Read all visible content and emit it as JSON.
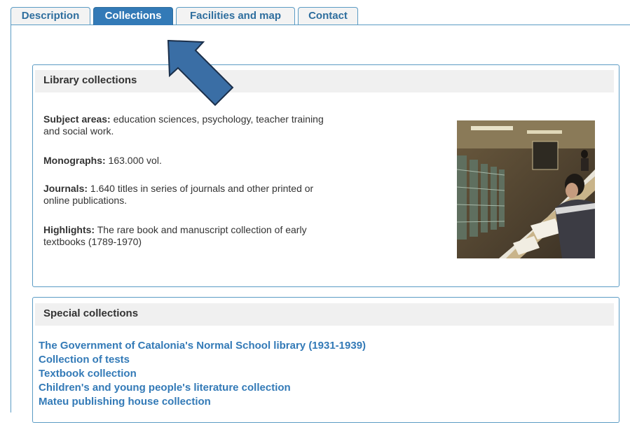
{
  "tabs": [
    {
      "label": "Description",
      "active": false
    },
    {
      "label": "Collections",
      "active": true
    },
    {
      "label": "Facilities and map",
      "active": false
    },
    {
      "label": "Contact",
      "active": false
    }
  ],
  "library": {
    "heading": "Library collections",
    "subject": {
      "label": "Subject areas:",
      "text": " education sciences, psychology, teacher training and social work."
    },
    "monographs": {
      "label": "Monographs:",
      "text": " 163.000 vol."
    },
    "journals": {
      "label": "Journals:",
      "text": " 1.640 titles in series of journals and other printed or online publications."
    },
    "highlights": {
      "label": "Highlights:",
      "text": " The rare book and manuscript collection of early textbooks (1789-1970)"
    }
  },
  "special": {
    "heading": "Special collections",
    "links": [
      "The Government of Catalonia's Normal School library (1931-1939)",
      "Collection of tests",
      "Textbook collection",
      "Children's and young people's literature collection",
      "Mateu publishing house collection"
    ]
  },
  "colors": {
    "accent": "#337ab7",
    "border": "#5b9bc4",
    "arrow": "#3a6ea5"
  }
}
